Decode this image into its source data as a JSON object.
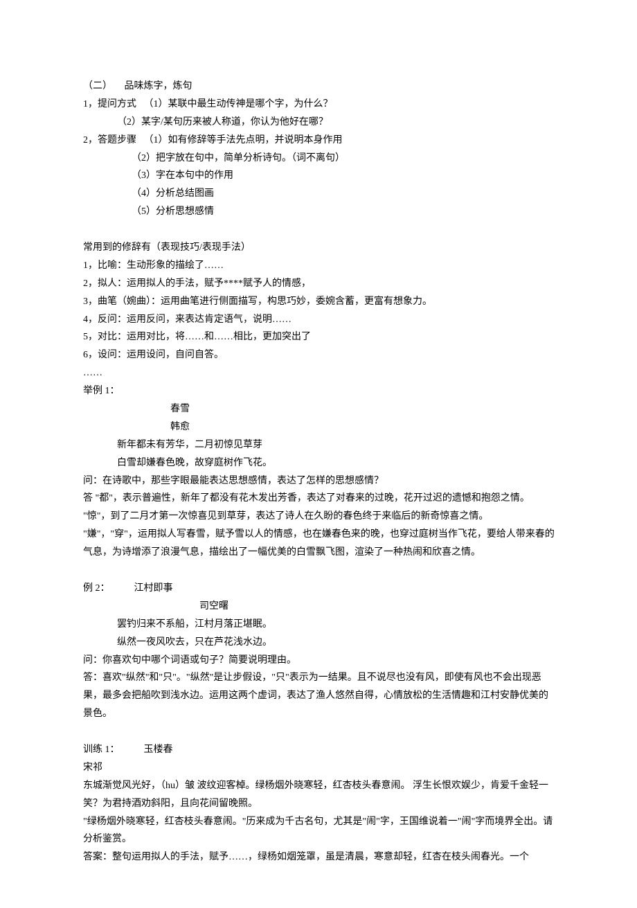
{
  "header": {
    "sec_label": "（二）",
    "sec_title": "品味炼字，炼句"
  },
  "q_methods": {
    "label": "1，提问方式",
    "item1": "（1）某联中最生动传神是哪个字，为什么？",
    "item2": "（2）某字/某句历来被人称道，你认为他好在哪？"
  },
  "steps": {
    "label": "2，答题步骤",
    "item1": "（1）如有修辞等手法先点明，并说明本身作用",
    "item2": "（2）把字放在句中，简单分析诗句。（词不离句）",
    "item3": "（3）字在本句中的作用",
    "item4": "（4）分析总结图画",
    "item5": "（5）分析思想感情"
  },
  "rhetoric": {
    "heading": "常用到的修辞有（表现技巧/表现手法）",
    "r1": "1，比喻：生动形象的描绘了……",
    "r2": "2，拟人：运用拟人的手法，赋予****赋予人的情感，",
    "r3": "3，曲笔（婉曲）：运用曲笔进行侧面描写，构思巧妙，委婉含蓄，更富有想象力。",
    "r4": "4，反问：运用反问，来表达肯定语气，说明……",
    "r5": "5，对比：运用对比，将……和……相比，更加突出了",
    "r6": "6，设问：运用设问，自问自答。",
    "ell": "……"
  },
  "ex1": {
    "label": "举例 1：",
    "title": "春雪",
    "author": "韩愈",
    "line1": "新年都未有芳华，二月初惊见草芽",
    "line2": "白雪却嫌春色晚，故穿庭树作飞花。",
    "q": "问：在诗歌中，那些字眼最能表达思想感情，表达了怎样的思想感情？",
    "a1": "答 \"都\"，表示普遍性，新年了都没有花木发出芳香，表达了对春来的过晚，花开过迟的遗憾和抱怨之情。",
    "a2": "\"惊\"，到了二月才第一次惊喜见到草芽，表达了诗人在久盼的春色终于来临后的新奇惊喜之情。",
    "a3": "\"嫌\"，\"穿\"，运用拟人写春雪，赋予雪以人的情感，也在嫌春色来的晚，也穿过庭树当作飞花，要给人带来春的气息，为诗增添了浪漫气息，描绘出了一幅优美的白雪飘飞图，渲染了一种热闹和欣喜之情。"
  },
  "ex2": {
    "label": "例 2：",
    "title": "江村即事",
    "author": "司空曙",
    "line1": "罢钓归来不系船，江村月落正堪眠。",
    "line2": "纵然一夜风吹去，只在芦花浅水边。",
    "q": "问：你喜欢句中哪个词语或句子？简要说明理由。",
    "a": "答：喜欢\"纵然\"和\"只\"。\"纵然\"是让步假设，\"只\"表示为一结果。且不说尽也没有风，即使有风也不会出现恶果，最多会把船吹到浅水边。运用这两个虚词，表达了渔人悠然自得，心情放松的生活情趣和江村安静优美的景色。"
  },
  "train1": {
    "label": "训练 1：",
    "title": "玉楼春",
    "author": "宋祁",
    "body": "东城渐觉风光好，（hu）皱 波纹迎客棹。绿杨烟外晓寒轻，红杏枝头春意闹。   浮生长恨欢娱少，肯爱千金轻一笑？为君持酒劝斜阳，且向花间留晚照。",
    "q": "\"绿杨烟外晓寒轻，红杏枝头春意闹。\"历来成为千古名句，尤其是\"闹\"字，王国维说着一\"闹\"字而境界全出。请分析鉴赏。",
    "a": "答案：整句运用拟人的手法，赋予……，绿杨如烟笼罩，虽是清晨，寒意却轻，红杏在枝头闹春光。一个"
  }
}
